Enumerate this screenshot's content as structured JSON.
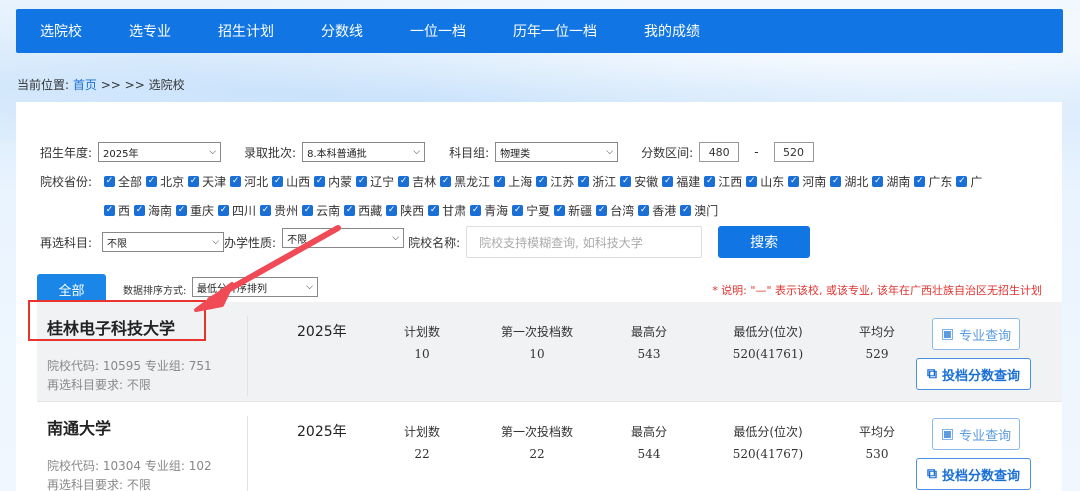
{
  "nav": [
    "选院校",
    "选专业",
    "招生计划",
    "分数线",
    "一位一档",
    "历年一位一档",
    "我的成绩"
  ],
  "breadcrumb": {
    "prefix": "当前位置:",
    "home": "首页",
    "rest": ">> >> 选院校"
  },
  "filters": {
    "year_label": "招生年度:",
    "year_value": "2025年",
    "batch_label": "录取批次:",
    "batch_value": "8.本科普通批",
    "group_label": "科目组:",
    "group_value": "物理类",
    "range_label": "分数区间:",
    "range_min": "480",
    "range_sep": "-",
    "range_max": "520",
    "province_label": "院校省份:",
    "provinces_row1": [
      "全部",
      "北京",
      "天津",
      "河北",
      "山西",
      "内蒙",
      "辽宁",
      "吉林",
      "黑龙江",
      "上海",
      "江苏",
      "浙江",
      "安徽",
      "福建",
      "江西",
      "山东",
      "河南",
      "湖北",
      "湖南",
      "广东",
      "广"
    ],
    "provinces_row2": [
      "西",
      "海南",
      "重庆",
      "四川",
      "贵州",
      "云南",
      "西藏",
      "陕西",
      "甘肃",
      "青海",
      "宁夏",
      "新疆",
      "台湾",
      "香港",
      "澳门"
    ],
    "subject_label": "再选科目:",
    "subject_value": "不限",
    "nature_label": "办学性质:",
    "nature_value": "不限",
    "school_label": "院校名称:",
    "school_placeholder": "院校支持模糊查询, 如科技大学",
    "search_button": "搜索"
  },
  "tab_all": "全部",
  "sort": {
    "label": "数据排序方式:",
    "value": "最低分升序排列"
  },
  "note": "* 说明: \"—\" 表示该校, 或该专业, 该年在广西壮族自治区无招生计划",
  "stat_headers": [
    "计划数",
    "第一次投档数",
    "最高分",
    "最低分(位次)",
    "平均分"
  ],
  "buttons": {
    "major": "专业查询",
    "score": "投档分数查询"
  },
  "results": [
    {
      "name": "桂林电子科技大学",
      "code": "院校代码: 10595   专业组: 751",
      "req": "再选科目要求: 不限",
      "year": "2025年",
      "values": [
        "10",
        "10",
        "543",
        "520(41761)",
        "529"
      ]
    },
    {
      "name": "南通大学",
      "code": "院校代码: 10304   专业组: 102",
      "req": "再选科目要求: 不限",
      "year": "2025年",
      "values": [
        "22",
        "22",
        "544",
        "520(41767)",
        "530"
      ]
    }
  ],
  "colors": {
    "primary": "#1176e3",
    "accent_red": "#e8342c",
    "note_red": "#e0332f"
  }
}
